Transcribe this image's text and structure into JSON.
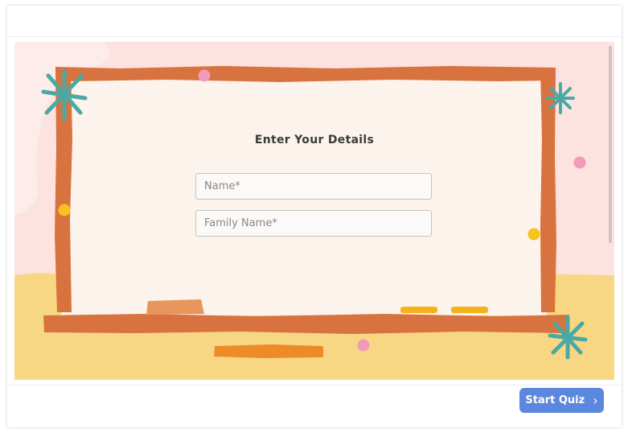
{
  "form": {
    "title": "Enter Your Details",
    "name_placeholder": "Name*",
    "name_value": "",
    "family_placeholder": "Family Name*",
    "family_value": ""
  },
  "footer": {
    "start_label": "Start Quiz",
    "chevron_glyph": "›"
  },
  "colors": {
    "background_pink": "#fde3df",
    "floor_yellow": "#f8d784",
    "board_frame": "#d8733f",
    "board_surface": "#fbf3ec",
    "star_teal": "#4aa9a4",
    "dot_pink": "#f09bb8",
    "dot_yellow": "#f6c21b",
    "button_blue": "#5b87de"
  }
}
